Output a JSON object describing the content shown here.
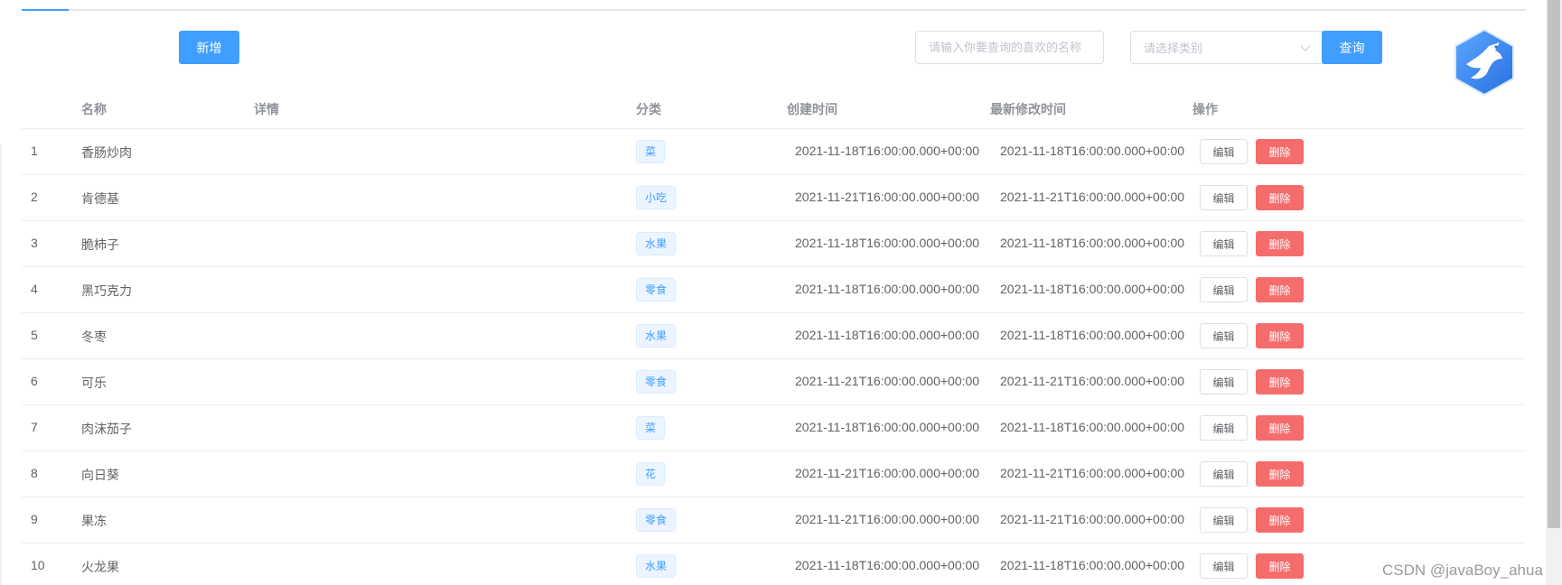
{
  "toolbar": {
    "add_label": "新增",
    "search_placeholder": "请输入你要查询的喜欢的名称",
    "category_placeholder": "请选择类别",
    "search_label": "查询"
  },
  "table": {
    "columns": {
      "name": "名称",
      "detail": "详情",
      "category": "分类",
      "created": "创建时间",
      "modified": "最新修改时间",
      "actions": "操作"
    },
    "edit_label": "编辑",
    "delete_label": "删除",
    "rows": [
      {
        "index": "1",
        "name": "香肠炒肉",
        "category": "菜",
        "created": "2021-11-18T16:00:00.000+00:00",
        "modified": "2021-11-18T16:00:00.000+00:00"
      },
      {
        "index": "2",
        "name": "肯德基",
        "category": "小吃",
        "created": "2021-11-21T16:00:00.000+00:00",
        "modified": "2021-11-21T16:00:00.000+00:00"
      },
      {
        "index": "3",
        "name": "脆柿子",
        "category": "水果",
        "created": "2021-11-18T16:00:00.000+00:00",
        "modified": "2021-11-18T16:00:00.000+00:00"
      },
      {
        "index": "4",
        "name": "黑巧克力",
        "category": "零食",
        "created": "2021-11-18T16:00:00.000+00:00",
        "modified": "2021-11-18T16:00:00.000+00:00"
      },
      {
        "index": "5",
        "name": "冬枣",
        "category": "水果",
        "created": "2021-11-18T16:00:00.000+00:00",
        "modified": "2021-11-18T16:00:00.000+00:00"
      },
      {
        "index": "6",
        "name": "可乐",
        "category": "零食",
        "created": "2021-11-21T16:00:00.000+00:00",
        "modified": "2021-11-21T16:00:00.000+00:00"
      },
      {
        "index": "7",
        "name": "肉沫茄子",
        "category": "菜",
        "created": "2021-11-18T16:00:00.000+00:00",
        "modified": "2021-11-18T16:00:00.000+00:00"
      },
      {
        "index": "8",
        "name": "向日葵",
        "category": "花",
        "created": "2021-11-21T16:00:00.000+00:00",
        "modified": "2021-11-21T16:00:00.000+00:00"
      },
      {
        "index": "9",
        "name": "果冻",
        "category": "零食",
        "created": "2021-11-21T16:00:00.000+00:00",
        "modified": "2021-11-21T16:00:00.000+00:00"
      },
      {
        "index": "10",
        "name": "火龙果",
        "category": "水果",
        "created": "2021-11-18T16:00:00.000+00:00",
        "modified": "2021-11-18T16:00:00.000+00:00"
      }
    ]
  },
  "watermark": "CSDN @javaBoy_ahua",
  "icons": {
    "logo": "bird-hexagon-logo-icon",
    "select_arrow": "chevron-down-icon"
  },
  "colors": {
    "primary": "#409eff",
    "danger": "#f56c6c",
    "tag_bg": "#ecf5ff"
  }
}
